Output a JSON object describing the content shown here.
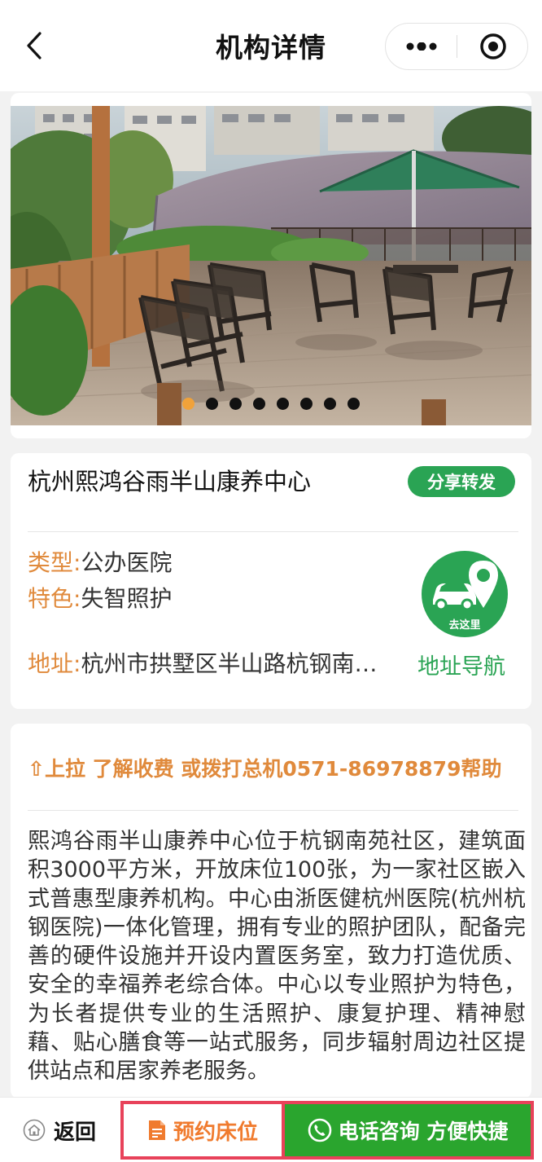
{
  "navbar": {
    "title": "机构详情",
    "back_icon": "chevron-left-icon",
    "more_icon": "more-dots-icon",
    "close_icon": "target-close-icon"
  },
  "gallery": {
    "image": "rooftop-terrace-photo",
    "slide_count": 8,
    "active_index": 0
  },
  "org": {
    "name": "杭州熙鸿谷雨半山康养中心",
    "share_label": "分享转发",
    "type_key": "类型:",
    "type_value": "公办医院",
    "feature_key": "特色:",
    "feature_value": "失智照护",
    "address_key": "地址:",
    "address_value": "杭州市拱墅区半山路杭钢南…",
    "goto_label": "去这里",
    "address_nav_label": "地址导航",
    "colors": {
      "accent_orange": "#e08a3c",
      "accent_green": "#2aa454"
    }
  },
  "description": {
    "pull_tip": "⇧上拉 了解收费 或拨打总机0571-86978879帮助",
    "text": "熙鸿谷雨半山康养中心位于杭钢南苑社区，建筑面积3000平方米，开放床位100张，为一家社区嵌入式普惠型康养机构。中心由浙医健杭州医院(杭州杭钢医院)一体化管理，拥有专业的照护团队，配备完善的硬件设施并开设内置医务室，致力打造优质、安全的幸福养老综合体。中心以专业照护为特色，为长者提供专业的生活照护、康复护理、精神慰藉、贴心膳食等一站式服务，同步辐射周边社区提供站点和居家养老服务。"
  },
  "bottombar": {
    "back_label": "返回",
    "book_label": "预约床位",
    "call_label": "电话咨询 方便快捷",
    "colors": {
      "call_bg": "#2aa52e",
      "highlight_border": "#e8425a"
    }
  }
}
